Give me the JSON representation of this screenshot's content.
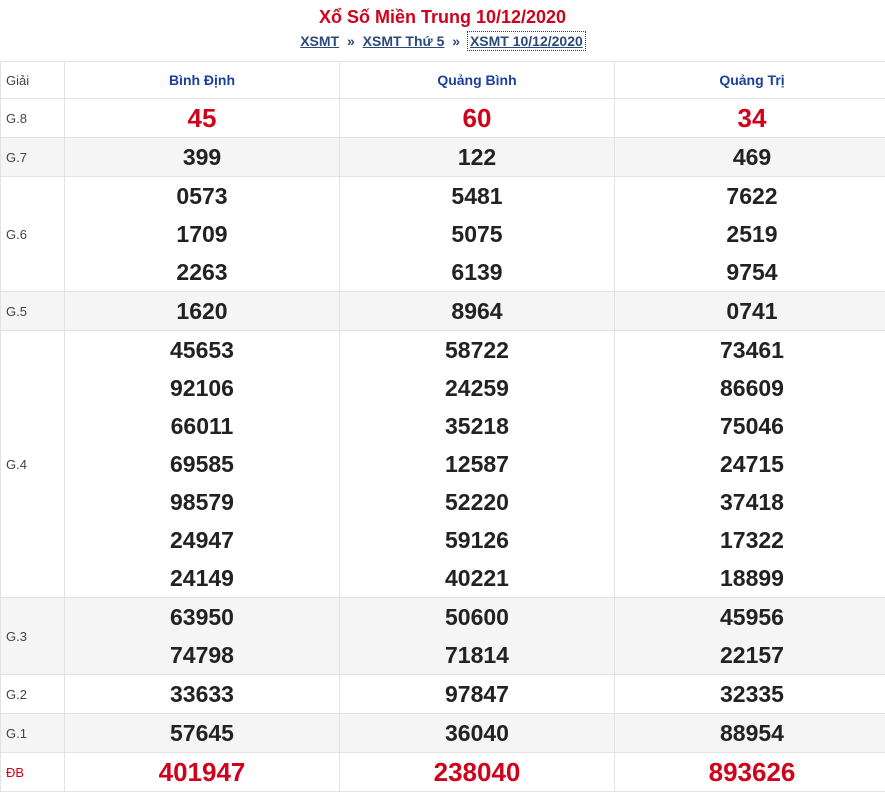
{
  "header": {
    "title": "Xổ Số Miền Trung 10/12/2020",
    "breadcrumb": [
      {
        "label": "XSMT"
      },
      {
        "label": "XSMT Thứ 5"
      },
      {
        "label": "XSMT 10/12/2020"
      }
    ],
    "separator": "»"
  },
  "table": {
    "label_header": "Giải",
    "provinces": [
      "Bình Định",
      "Quảng Bình",
      "Quảng Trị"
    ],
    "rows": [
      {
        "label": "G.8",
        "values": [
          [
            "45"
          ],
          [
            "60"
          ],
          [
            "34"
          ]
        ]
      },
      {
        "label": "G.7",
        "values": [
          [
            "399"
          ],
          [
            "122"
          ],
          [
            "469"
          ]
        ]
      },
      {
        "label": "G.6",
        "values": [
          [
            "0573",
            "1709",
            "2263"
          ],
          [
            "5481",
            "5075",
            "6139"
          ],
          [
            "7622",
            "2519",
            "9754"
          ]
        ]
      },
      {
        "label": "G.5",
        "values": [
          [
            "1620"
          ],
          [
            "8964"
          ],
          [
            "0741"
          ]
        ]
      },
      {
        "label": "G.4",
        "values": [
          [
            "45653",
            "92106",
            "66011",
            "69585",
            "98579",
            "24947",
            "24149"
          ],
          [
            "58722",
            "24259",
            "35218",
            "12587",
            "52220",
            "59126",
            "40221"
          ],
          [
            "73461",
            "86609",
            "75046",
            "24715",
            "37418",
            "17322",
            "18899"
          ]
        ]
      },
      {
        "label": "G.3",
        "values": [
          [
            "63950",
            "74798"
          ],
          [
            "50600",
            "71814"
          ],
          [
            "45956",
            "22157"
          ]
        ]
      },
      {
        "label": "G.2",
        "values": [
          [
            "33633"
          ],
          [
            "97847"
          ],
          [
            "32335"
          ]
        ]
      },
      {
        "label": "G.1",
        "values": [
          [
            "57645"
          ],
          [
            "36040"
          ],
          [
            "88954"
          ]
        ]
      },
      {
        "label": "ĐB",
        "values": [
          [
            "401947"
          ],
          [
            "238040"
          ],
          [
            "893626"
          ]
        ]
      }
    ]
  },
  "colors": {
    "accent_red": "#d0021b",
    "province_blue": "#1a3f9c",
    "link": "#2a4a7a"
  }
}
